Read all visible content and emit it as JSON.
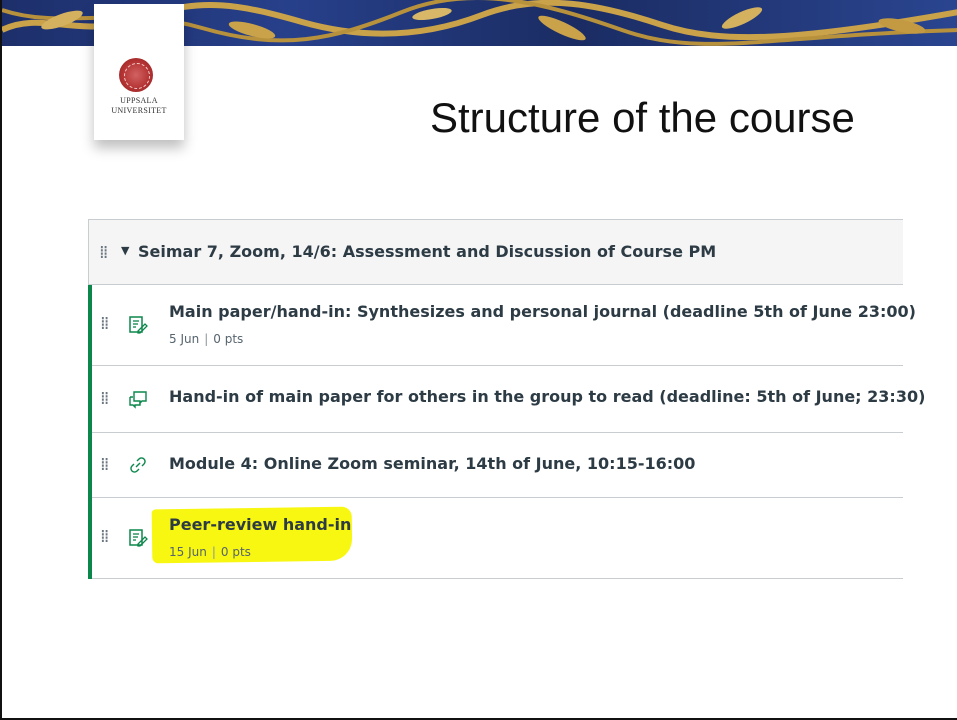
{
  "slide": {
    "title": "Structure of the course",
    "logo": {
      "university": "UPPSALA\nUNIVERSITET"
    }
  },
  "module": {
    "title": "Seimar 7, Zoom, 14/6: Assessment and Discussion of Course PM",
    "items": [
      {
        "type": "assignment",
        "title": "Main paper/hand-in: Synthesizes and personal journal (deadline 5th of June 23:00)",
        "date": "5 Jun",
        "points": "0 pts"
      },
      {
        "type": "discussion",
        "title": "Hand-in of main paper for others in the group to read (deadline: 5th of June; 23:30)"
      },
      {
        "type": "external-link",
        "title": "Module 4: Online Zoom seminar, 14th of June, 10:15-16:00"
      },
      {
        "type": "assignment",
        "title": "Peer-review hand-in",
        "date": "15 Jun",
        "points": "0 pts",
        "highlighted": true
      }
    ]
  },
  "colors": {
    "accent": "#0b874b",
    "text": "#2d3b45",
    "highlight": "#f7f712",
    "banner": "#1d2f6b"
  },
  "icons": {
    "drag": "drag-handle-icon",
    "assignment": "assignment-icon",
    "discussion": "discussion-icon",
    "link": "link-icon",
    "caret": "caret-down-icon"
  }
}
